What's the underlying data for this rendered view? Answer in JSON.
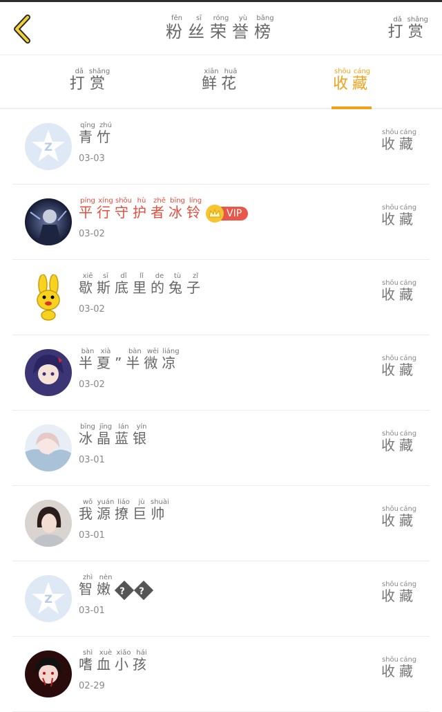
{
  "header": {
    "title_pinyin": [
      "fěn",
      "sī",
      "róng",
      "yù",
      "bǎng"
    ],
    "title_chars": [
      "粉",
      "丝",
      "荣",
      "誉",
      "榜"
    ],
    "reward_pinyin": [
      "dǎ",
      "shǎng"
    ],
    "reward_chars": [
      "打",
      "赏"
    ]
  },
  "tabs": [
    {
      "pinyin": [
        "dǎ",
        "shǎng"
      ],
      "chars": [
        "打",
        "赏"
      ],
      "active": false
    },
    {
      "pinyin": [
        "xiān",
        "huā"
      ],
      "chars": [
        "鲜",
        "花"
      ],
      "active": false
    },
    {
      "pinyin": [
        "shōu",
        "cáng"
      ],
      "chars": [
        "收",
        "藏"
      ],
      "active": true
    }
  ],
  "fav_label": {
    "pinyin": [
      "shōu",
      "cáng"
    ],
    "chars": [
      "收",
      "藏"
    ]
  },
  "colors": {
    "accent": "#f2a11a",
    "vip_name": "#e74c3c",
    "vip_badge": "#e9574a",
    "crown": "#f7c531"
  },
  "fans": [
    {
      "pinyin": [
        "qīng",
        "zhú"
      ],
      "chars": [
        "青",
        "竹"
      ],
      "date": "03-03",
      "avatar": "qq-default-icon",
      "vip": false
    },
    {
      "pinyin": [
        "píng",
        "xíng",
        "shǒu",
        "hù",
        "zhě",
        "bīng",
        "líng"
      ],
      "chars": [
        "平",
        "行",
        "守",
        "护",
        "者",
        "冰",
        "铃"
      ],
      "date": "03-02",
      "avatar": "dark-character-avatar",
      "vip": true,
      "vip_label": "VIP"
    },
    {
      "pinyin": [
        "xiē",
        "sī",
        "dǐ",
        "lǐ",
        "de",
        "tù",
        "zǐ"
      ],
      "chars": [
        "歇",
        "斯",
        "底",
        "里",
        "的",
        "兔",
        "子"
      ],
      "date": "03-02",
      "avatar": "yellow-rabbit-avatar",
      "vip": false
    },
    {
      "pinyin": [
        "bàn",
        "xià",
        "",
        "bàn",
        "wēi",
        "liáng"
      ],
      "chars": [
        "半",
        "夏",
        "”",
        "半",
        "微",
        "凉"
      ],
      "date": "03-02",
      "avatar": "anime-girl-avatar",
      "vip": false
    },
    {
      "pinyin": [
        "bīng",
        "jīng",
        "lán",
        "yín"
      ],
      "chars": [
        "冰",
        "晶",
        "蓝",
        "银"
      ],
      "date": "03-01",
      "avatar": "pastel-anime-avatar",
      "vip": false
    },
    {
      "pinyin": [
        "wǒ",
        "yuán",
        "liáo",
        "jù",
        "shuài"
      ],
      "chars": [
        "我",
        "源",
        "撩",
        "巨",
        "帅"
      ],
      "date": "03-01",
      "avatar": "portrait-avatar",
      "vip": false
    },
    {
      "pinyin": [
        "zhì",
        "nèn"
      ],
      "chars": [
        "智",
        "嫩"
      ],
      "date": "03-01",
      "avatar": "qq-default-icon",
      "vip": false,
      "suffix": [
        "?",
        "?"
      ]
    },
    {
      "pinyin": [
        "shì",
        "xuè",
        "xiǎo",
        "hái"
      ],
      "chars": [
        "嗜",
        "血",
        "小",
        "孩"
      ],
      "date": "02-29",
      "avatar": "red-anime-avatar",
      "vip": false
    }
  ]
}
